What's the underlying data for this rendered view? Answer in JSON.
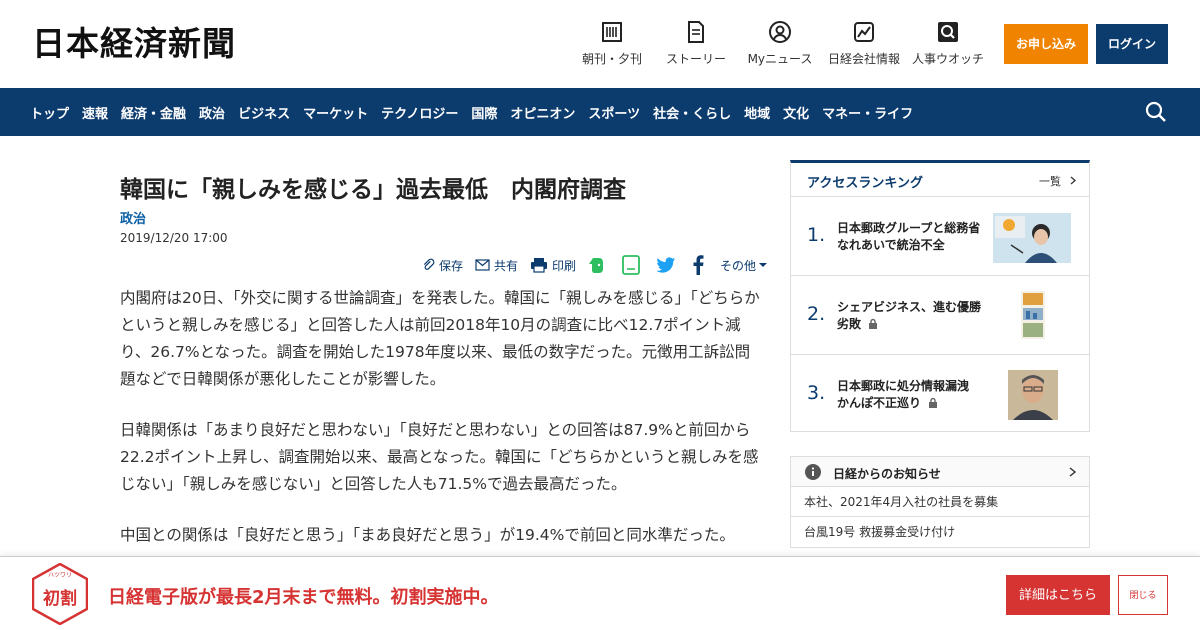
{
  "header": {
    "logo": "日本経済新聞",
    "nav": [
      {
        "label": "朝刊・夕刊",
        "icon": "newspaper-icon"
      },
      {
        "label": "ストーリー",
        "icon": "document-icon"
      },
      {
        "label": "Myニュース",
        "icon": "user-icon"
      },
      {
        "label": "日経会社情報",
        "icon": "chart-icon"
      },
      {
        "label": "人事ウオッチ",
        "icon": "search-person-icon"
      }
    ],
    "apply_label": "お申し込み",
    "login_label": "ログイン"
  },
  "navbar": {
    "items": [
      "トップ",
      "速報",
      "経済・金融",
      "政治",
      "ビジネス",
      "マーケット",
      "テクノロジー",
      "国際",
      "オピニオン",
      "スポーツ",
      "社会・くらし",
      "地域",
      "文化",
      "マネー・ライフ"
    ]
  },
  "article": {
    "title": "韓国に「親しみを感じる」過去最低　内閣府調査",
    "category": "政治",
    "date": "2019/12/20 17:00",
    "tools": {
      "save": "保存",
      "share": "共有",
      "print": "印刷",
      "more": "その他"
    },
    "paragraphs": [
      "内閣府は20日、「外交に関する世論調査」を発表した。韓国に「親しみを感じる」「どちらかというと親しみを感じる」と回答した人は前回2018年10月の調査に比べ12.7ポイント減り、26.7%となった。調査を開始した1978年度以来、最低の数字だった。元徴用工訴訟問題などで日韓関係が悪化したことが影響した。",
      "日韓関係は「あまり良好だと思わない」「良好だと思わない」との回答は87.9%と前回から22.2ポイント上昇し、調査開始以来、最高となった。韓国に「どちらかというと親しみを感じない」「親しみを感じない」と回答した人も71.5%で過去最高だった。",
      "中国との関係は「良好だと思う」「まあ良好だと思う」が19.4%で前回と同水準だった。"
    ]
  },
  "ranking": {
    "title": "アクセスランキング",
    "all_label": "一覧",
    "items": [
      {
        "rank": "1.",
        "text": "日本郵政グループと総務省　なれあいで統治不全",
        "locked": false
      },
      {
        "rank": "2.",
        "text": "シェアビジネス、進む優勝劣敗",
        "locked": true
      },
      {
        "rank": "3.",
        "text": "日本郵政に処分情報漏洩 かんぽ不正巡り",
        "locked": true
      }
    ]
  },
  "notice": {
    "title": "日経からのお知らせ",
    "items": [
      "本社、2021年4月入社の社員を募集",
      "台風19号 救援募金受け付け"
    ]
  },
  "banner": {
    "badge": "初割",
    "badge_ruby": "ハツワリ",
    "text": "日経電子版が最長2月末まで無料。初割実施中。",
    "detail_label": "詳細はこちら",
    "close_label": "閉じる"
  },
  "colors": {
    "navy": "#0c3b6e",
    "orange": "#f08300",
    "red": "#d63333",
    "link_blue": "#0b5fa5"
  }
}
